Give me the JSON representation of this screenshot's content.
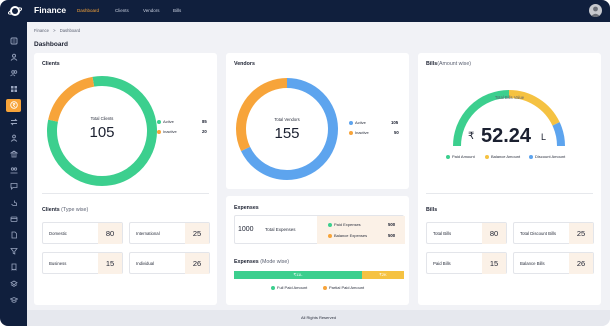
{
  "app": {
    "brand": "Finance",
    "nav": [
      "Dashboard",
      "Clients",
      "Vendors",
      "Bills"
    ],
    "active_nav": "Dashboard"
  },
  "sidebar": {
    "icons": [
      "list-icon",
      "user-icon",
      "users-icon",
      "grid-icon",
      "rupee-icon",
      "transfer-icon",
      "people-icon",
      "bank-icon",
      "group-icon",
      "chat-icon",
      "hand-icon",
      "card-icon",
      "document-icon",
      "filter-icon",
      "receipt-icon",
      "layers-icon",
      "cap-icon"
    ],
    "active_index": 4
  },
  "breadcrumb": {
    "root": "Finance",
    "separator": ">",
    "current": "Dashboard"
  },
  "page_title": "Dashboard",
  "clients": {
    "title": "Clients",
    "donut_label": "Total Clients",
    "donut_value": "105",
    "legend": [
      {
        "label": "Active",
        "value": "85",
        "color": "#3ccf8e"
      },
      {
        "label": "Inactive",
        "value": "20",
        "color": "#f7a43a"
      }
    ],
    "type_title": "Clients",
    "type_sub": "(Type wise)",
    "types": [
      {
        "label": "Domestic",
        "value": "80"
      },
      {
        "label": "International",
        "value": "25"
      },
      {
        "label": "Business",
        "value": "15"
      },
      {
        "label": "Individual",
        "value": "26"
      }
    ]
  },
  "vendors": {
    "title": "Vendors",
    "donut_label": "Total Vendors",
    "donut_value": "155",
    "legend": [
      {
        "label": "Active",
        "value": "105",
        "color": "#5da4ee"
      },
      {
        "label": "Inactive",
        "value": "50",
        "color": "#f7a43a"
      }
    ]
  },
  "expenses": {
    "title": "Expenses",
    "total_value": "1000",
    "total_label": "Total Expenses",
    "rows": [
      {
        "label": "Paid Expenses",
        "value": "500",
        "color": "#3ccf8e"
      },
      {
        "label": "Balance Expenses",
        "value": "500",
        "color": "#f7a43a"
      }
    ],
    "mode_title": "Expenses",
    "mode_sub": "(Mode wise)",
    "bar": {
      "full_label": "₹11L",
      "partial_label": "₹2K",
      "full_fraction": 0.75,
      "full_color": "#3ccf8e",
      "partial_color": "#f5c242"
    },
    "bar_legend": [
      {
        "label": "Full Paid Amount",
        "color": "#3ccf8e"
      },
      {
        "label": "Partial Paid Amount",
        "color": "#f7a43a"
      }
    ]
  },
  "bills": {
    "title": "Bills",
    "title_sub": "(Amount wise)",
    "gauge_label": "Total Bills Value",
    "gauge_currency": "₹",
    "gauge_value": "52.24",
    "gauge_unit": "L",
    "gauge_fractions": {
      "paid": 0.5,
      "balance": 0.36,
      "discount": 0.14
    },
    "legend": [
      {
        "label": "Paid Amount",
        "color": "#3ccf8e"
      },
      {
        "label": "Balance Amount",
        "color": "#f5c242"
      },
      {
        "label": "Discount Amount",
        "color": "#5da4ee"
      }
    ],
    "summary_title": "Bills",
    "items": [
      {
        "label": "Total Bills",
        "value": "80"
      },
      {
        "label": "Total Discount Bills",
        "value": "25"
      },
      {
        "label": "Paid Bills",
        "value": "15"
      },
      {
        "label": "Balance Bills",
        "value": "26"
      }
    ]
  },
  "footer": "All Rights Reserved"
}
